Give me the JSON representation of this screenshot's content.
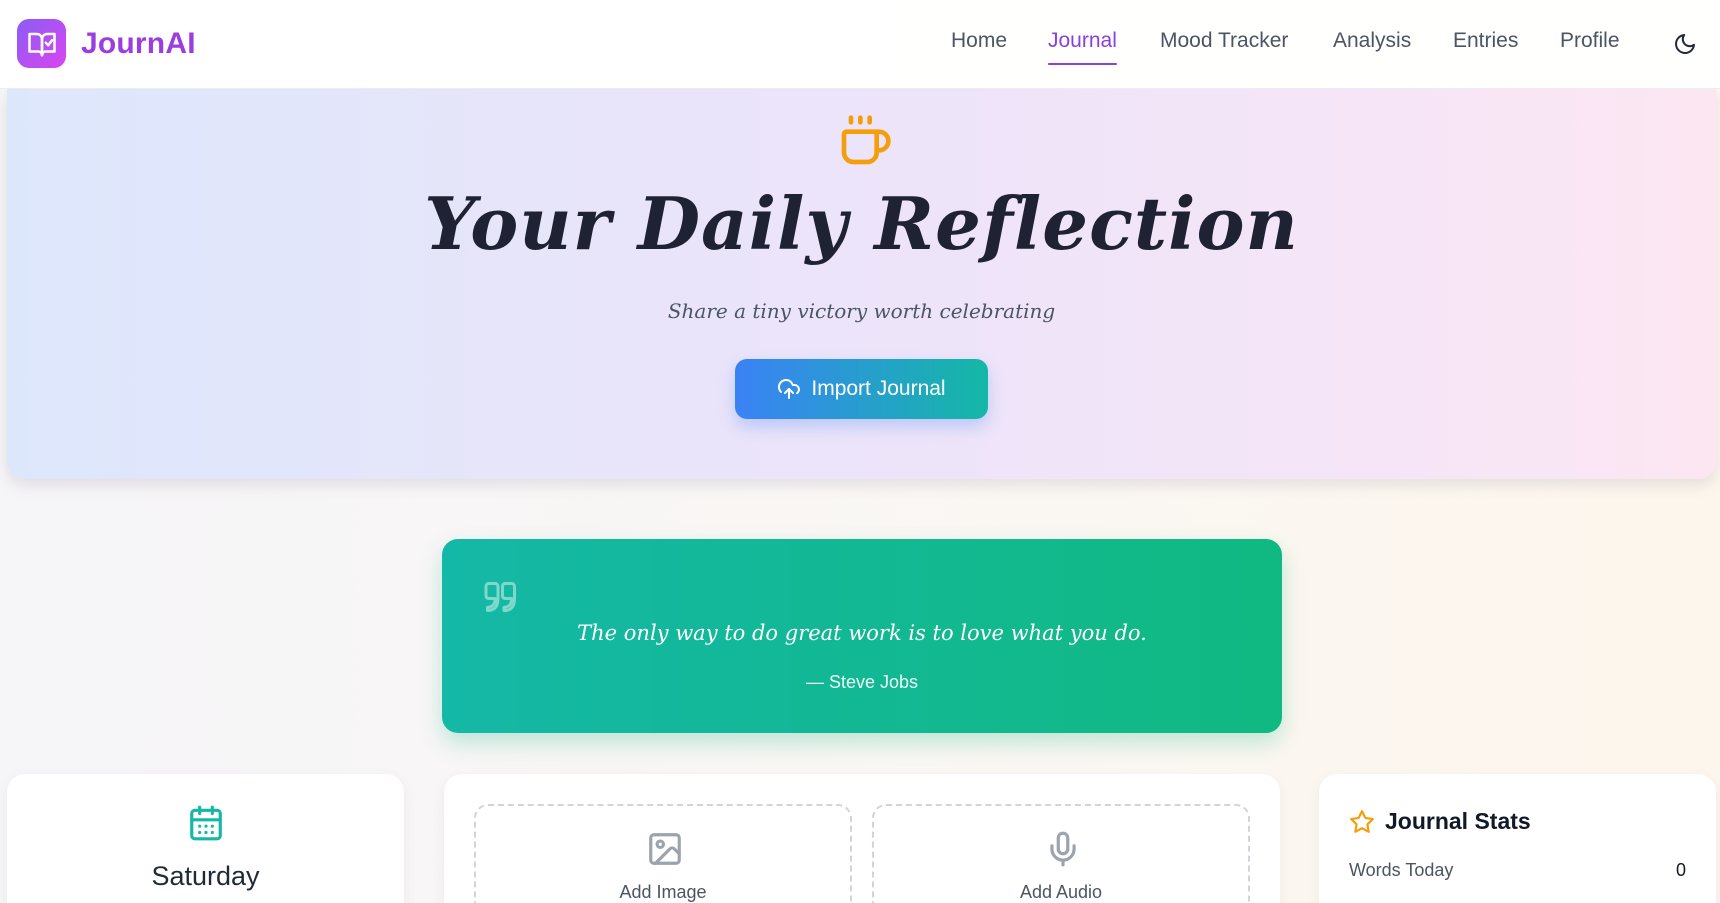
{
  "app": {
    "name": "JournAI",
    "logo_icon": "journal-book-check-icon",
    "brand_color": "#9b3de0"
  },
  "nav": {
    "items": [
      {
        "label": "Home",
        "active": false
      },
      {
        "label": "Journal",
        "active": true
      },
      {
        "label": "Mood Tracker",
        "active": false
      },
      {
        "label": "Analysis",
        "active": false
      },
      {
        "label": "Entries",
        "active": false
      },
      {
        "label": "Profile",
        "active": false
      }
    ],
    "theme_toggle_icon": "moon-icon",
    "active_color": "#8b3fe0"
  },
  "hero": {
    "icon": "coffee-cup-icon",
    "title": "Your Daily Reflection",
    "subtitle": "Share a tiny victory worth celebrating",
    "button_label": "Import Journal",
    "button_icon": "cloud-upload-icon"
  },
  "quote": {
    "icon": "quote-icon",
    "text": "The only way to do great work is to love what you do.",
    "author": "— Steve Jobs"
  },
  "date_card": {
    "icon": "calendar-icon",
    "day": "Saturday"
  },
  "media": {
    "add_image_label": "Add Image",
    "add_image_icon": "image-icon",
    "add_audio_label": "Add Audio",
    "add_audio_icon": "microphone-icon"
  },
  "stats": {
    "icon": "star-icon",
    "title": "Journal Stats",
    "words_today_label": "Words Today",
    "words_today_value": "0"
  }
}
